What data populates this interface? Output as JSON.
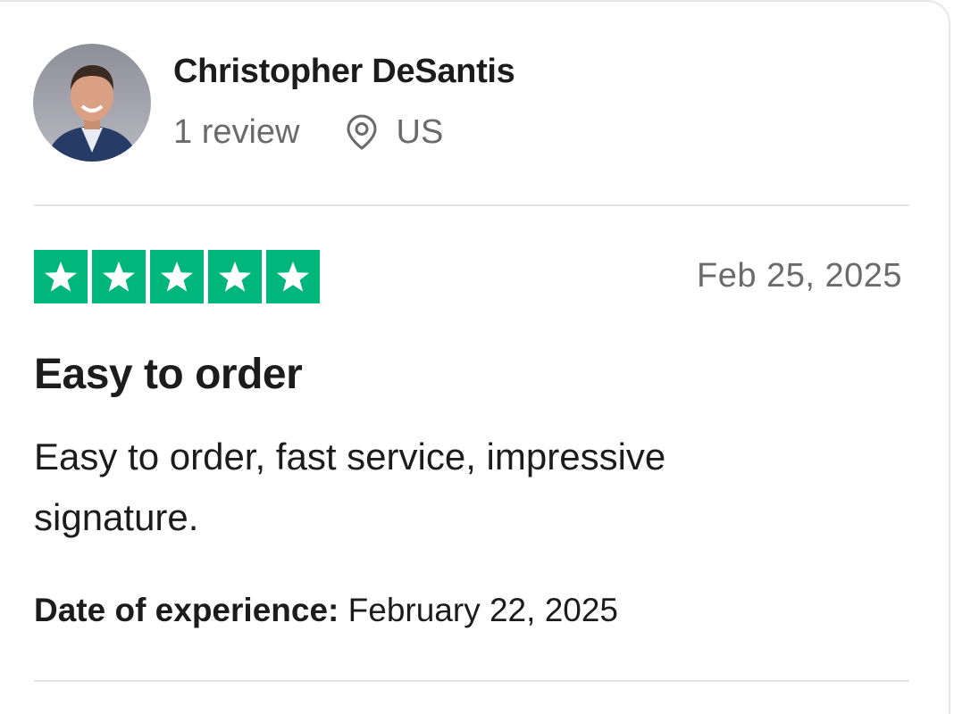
{
  "reviewer": {
    "name": "Christopher DeSantis",
    "review_count": "1 review",
    "country": "US",
    "avatar_icon": "person-photo-icon",
    "location_icon": "map-pin-icon"
  },
  "review": {
    "rating": 5,
    "rating_max": 5,
    "star_color": "#00b67a",
    "date": "Feb 25, 2025",
    "title": "Easy to order",
    "body": "Easy to order, fast service, impressive signature.",
    "experience_label": "Date of experience:",
    "experience_date": "February 22, 2025"
  }
}
